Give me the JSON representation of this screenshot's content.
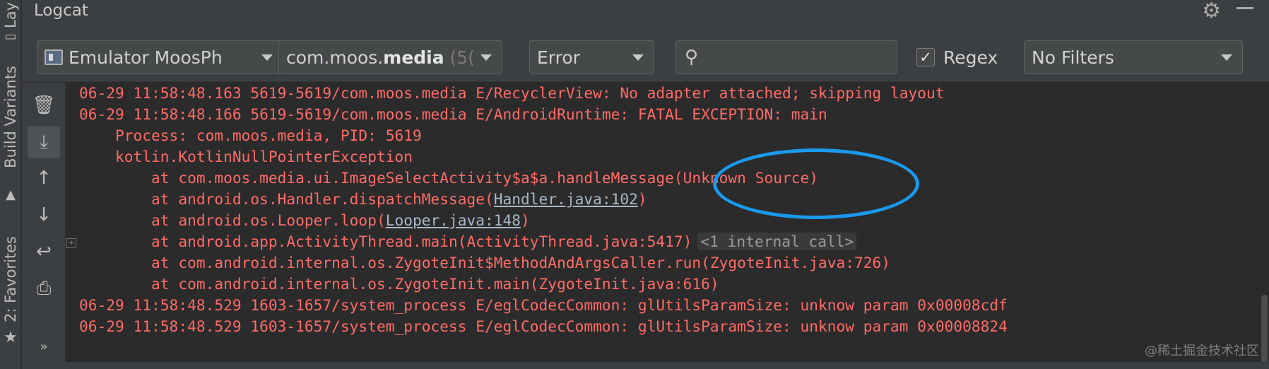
{
  "side_tabs": {
    "layout": "Lay",
    "build_variants": "Build Variants",
    "favorites": "2: Favorites"
  },
  "title_bar": {
    "title": "Logcat"
  },
  "toolbar": {
    "device": "Emulator MoosPh",
    "process_prefix": "com.moos.",
    "process_bold": "media",
    "process_suffix": " (5(",
    "log_level": "Error",
    "search": {
      "value": "",
      "placeholder": ""
    },
    "regex_label": "Regex",
    "regex_checked": true,
    "regex_mark": "✓",
    "filter": "No Filters"
  },
  "log": {
    "lines": [
      "06-29 11:58:48.163 5619-5619/com.moos.media E/RecyclerView: No adapter attached; skipping layout",
      "06-29 11:58:48.166 5619-5619/com.moos.media E/AndroidRuntime: FATAL EXCEPTION: main",
      "    Process: com.moos.media, PID: 5619",
      "    kotlin.KotlinNullPointerException",
      "        at com.moos.media.ui.ImageSelectActivity$a$a.handleMessage(Unknown Source)",
      {
        "pre": "        at android.os.Handler.dispatchMessage(",
        "link": "Handler.java:102",
        "post": ")"
      },
      {
        "pre": "        at android.os.Looper.loop(",
        "link": "Looper.java:148",
        "post": ")"
      },
      {
        "pre": "        at android.app.ActivityThread.main(ActivityThread.java:5417)",
        "note": "<1 internal call>"
      },
      "        at com.android.internal.os.ZygoteInit$MethodAndArgsCaller.run(ZygoteInit.java:726)",
      "        at com.android.internal.os.ZygoteInit.main(ZygoteInit.java:616)",
      "06-29 11:58:48.529 1603-1657/system_process E/eglCodecCommon: glUtilsParamSize: unknow param 0x00008cdf",
      "06-29 11:58:48.529 1603-1657/system_process E/eglCodecCommon: glUtilsParamSize: unknow param 0x00008824"
    ]
  },
  "watermark": "@稀土掘金技术社区",
  "colors": {
    "log_error": "#ff6b68",
    "annotation_ellipse": "#1a9aee",
    "panel_bg": "#3c3f41",
    "log_bg": "#2b2b2b"
  }
}
